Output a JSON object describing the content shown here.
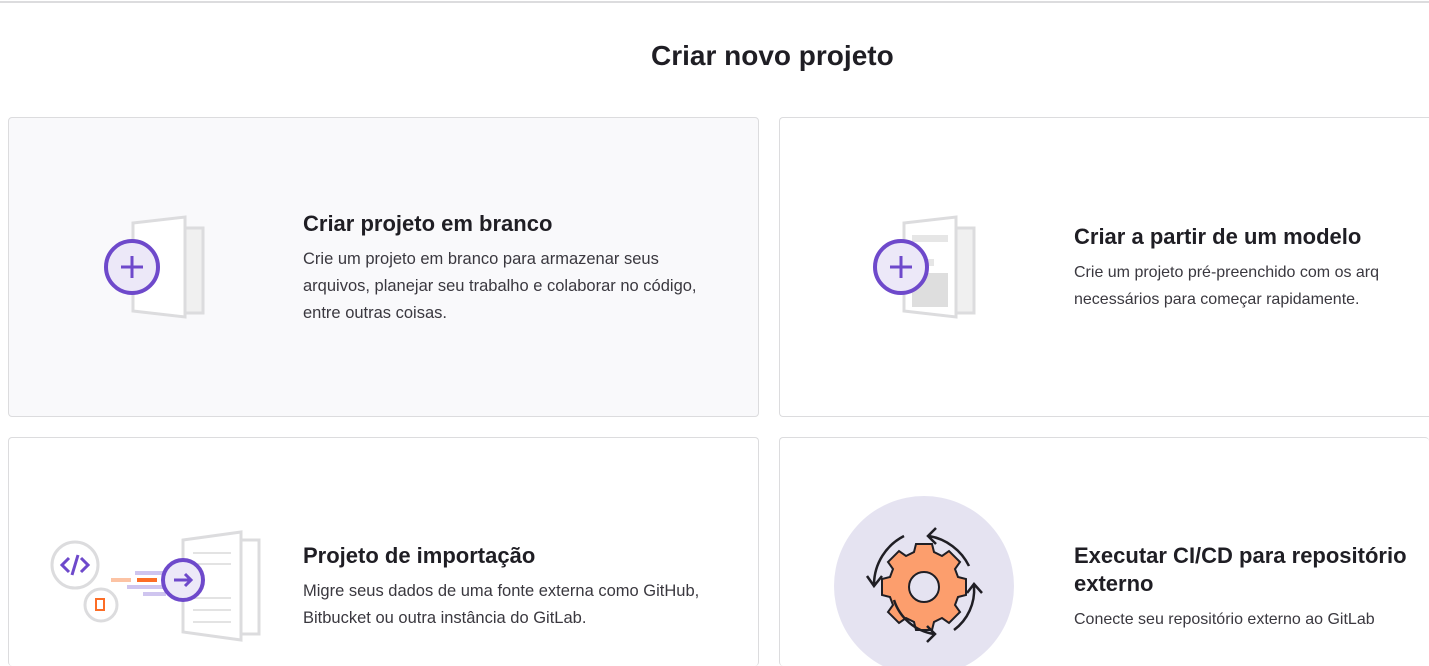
{
  "page": {
    "title": "Criar novo projeto"
  },
  "cards": [
    {
      "title": "Criar projeto em branco",
      "description": "Crie um projeto em branco para armazenar seus arquivos, planejar seu trabalho e colaborar no código, entre outras coisas.",
      "icon": "blank-project-icon"
    },
    {
      "title": "Criar a partir de um modelo",
      "description_lines": [
        "Crie um projeto pré-preenchido com os arq",
        "necessários para começar rapidamente."
      ],
      "icon": "template-project-icon"
    },
    {
      "title": "Projeto de importação",
      "description": "Migre seus dados de uma fonte externa como GitHub, Bitbucket ou outra instância do GitLab.",
      "icon": "import-project-icon"
    },
    {
      "title": "Executar CI/CD para repositório externo",
      "description": "Conecte seu repositório externo ao GitLab",
      "icon": "cicd-gear-icon"
    }
  ],
  "colors": {
    "accent": "#6e49cb",
    "orange": "#fc6d26",
    "gear": "#fc9e6d",
    "circle_bg": "#e5e3f1"
  }
}
